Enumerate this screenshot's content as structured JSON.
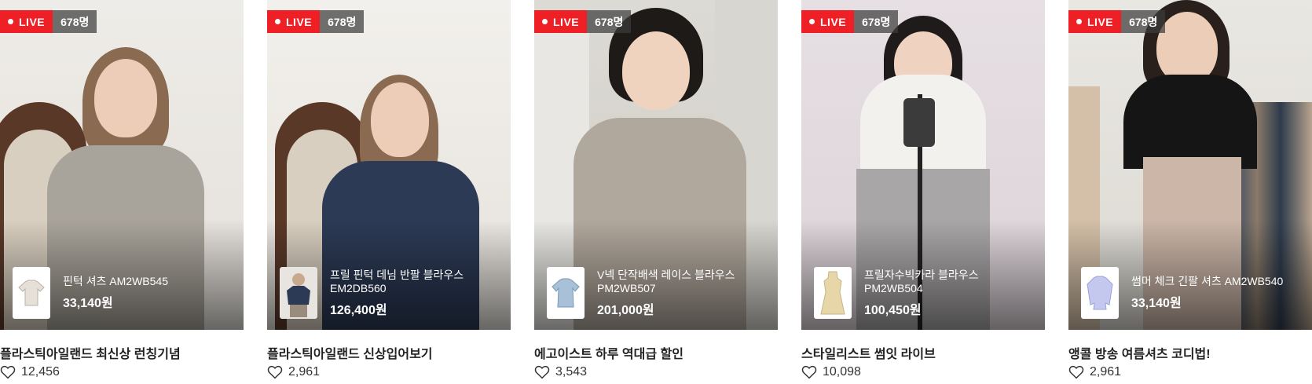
{
  "badge": {
    "live_label": "LIVE"
  },
  "cards": [
    {
      "viewers": "678명",
      "product_name": "핀턱 셔츠 AM2WB545",
      "product_price": "33,140원",
      "title": "플라스틱아일랜드 최신상 런칭기념",
      "likes": "12,456"
    },
    {
      "viewers": "678명",
      "product_name": "프릴 핀턱 데님 반팔 블라우스 EM2DB560",
      "product_price": "126,400원",
      "title": "플라스틱아일랜드 신상입어보기",
      "likes": "2,961"
    },
    {
      "viewers": "678명",
      "product_name": "V넥 단작배색 레이스 블라우스 PM2WB507",
      "product_price": "201,000원",
      "title": "에고이스트 하루 역대급 할인",
      "likes": "3,543"
    },
    {
      "viewers": "678명",
      "product_name": "프릴자수빅카라 블라우스 PM2WB504",
      "product_price": "100,450원",
      "title": "스타일리스트 썸잇 라이브",
      "likes": "10,098"
    },
    {
      "viewers": "678명",
      "product_name": "썸머 체크 긴팔 셔츠 AM2WB540",
      "product_price": "33,140원",
      "title": "앵콜 방송 여름셔츠 코디법!",
      "likes": "2,961"
    }
  ],
  "colors": {
    "live_red": "#ef1f26"
  }
}
